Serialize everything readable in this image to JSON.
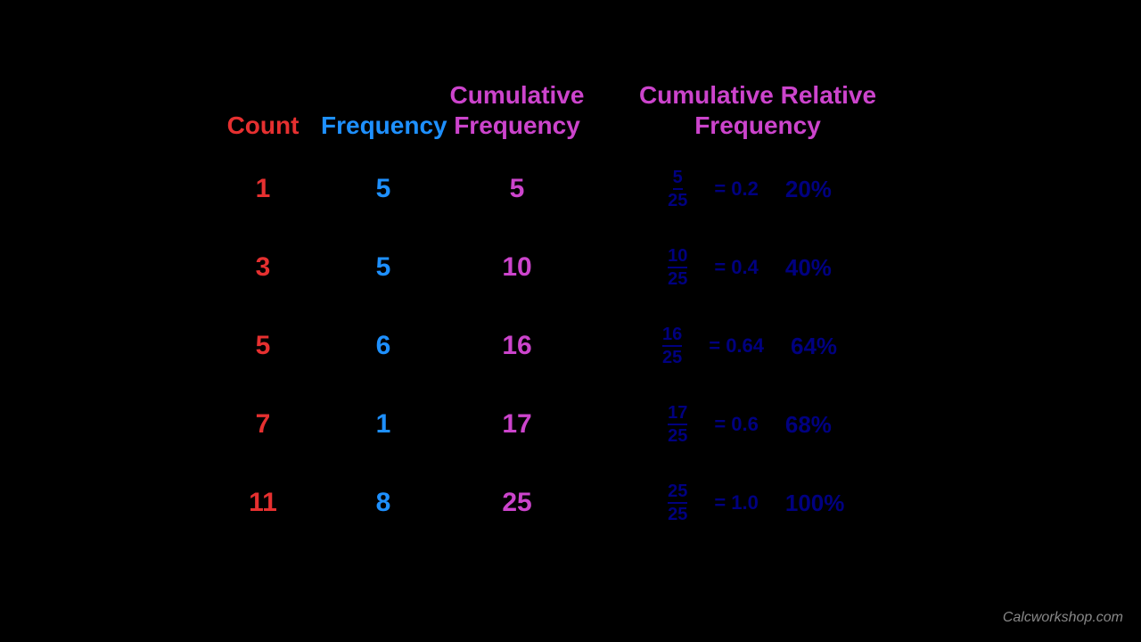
{
  "header": {
    "count": "Count",
    "frequency": "Frequency",
    "cumulative_frequency": "Cumulative Frequency",
    "cumulative_relative_frequency": "Cumulative Relative Frequency"
  },
  "rows": [
    {
      "count": "1",
      "frequency": "5",
      "cum_freq": "5",
      "frac_num": "5",
      "frac_den": "25",
      "decimal": "= 0.2",
      "percent": "20%"
    },
    {
      "count": "3",
      "frequency": "5",
      "cum_freq": "10",
      "frac_num": "10",
      "frac_den": "25",
      "decimal": "= 0.4",
      "percent": "40%"
    },
    {
      "count": "5",
      "frequency": "6",
      "cum_freq": "16",
      "frac_num": "16",
      "frac_den": "25",
      "decimal": "= 0.64",
      "percent": "64%"
    },
    {
      "count": "7",
      "frequency": "1",
      "cum_freq": "17",
      "frac_num": "17",
      "frac_den": "25",
      "decimal": "= 0.6",
      "percent": "68%"
    },
    {
      "count": "11",
      "frequency": "8",
      "cum_freq": "25",
      "frac_num": "25",
      "frac_den": "25",
      "decimal": "= 1.0",
      "percent": "100%"
    }
  ],
  "watermark": "Calcworkshop.com"
}
